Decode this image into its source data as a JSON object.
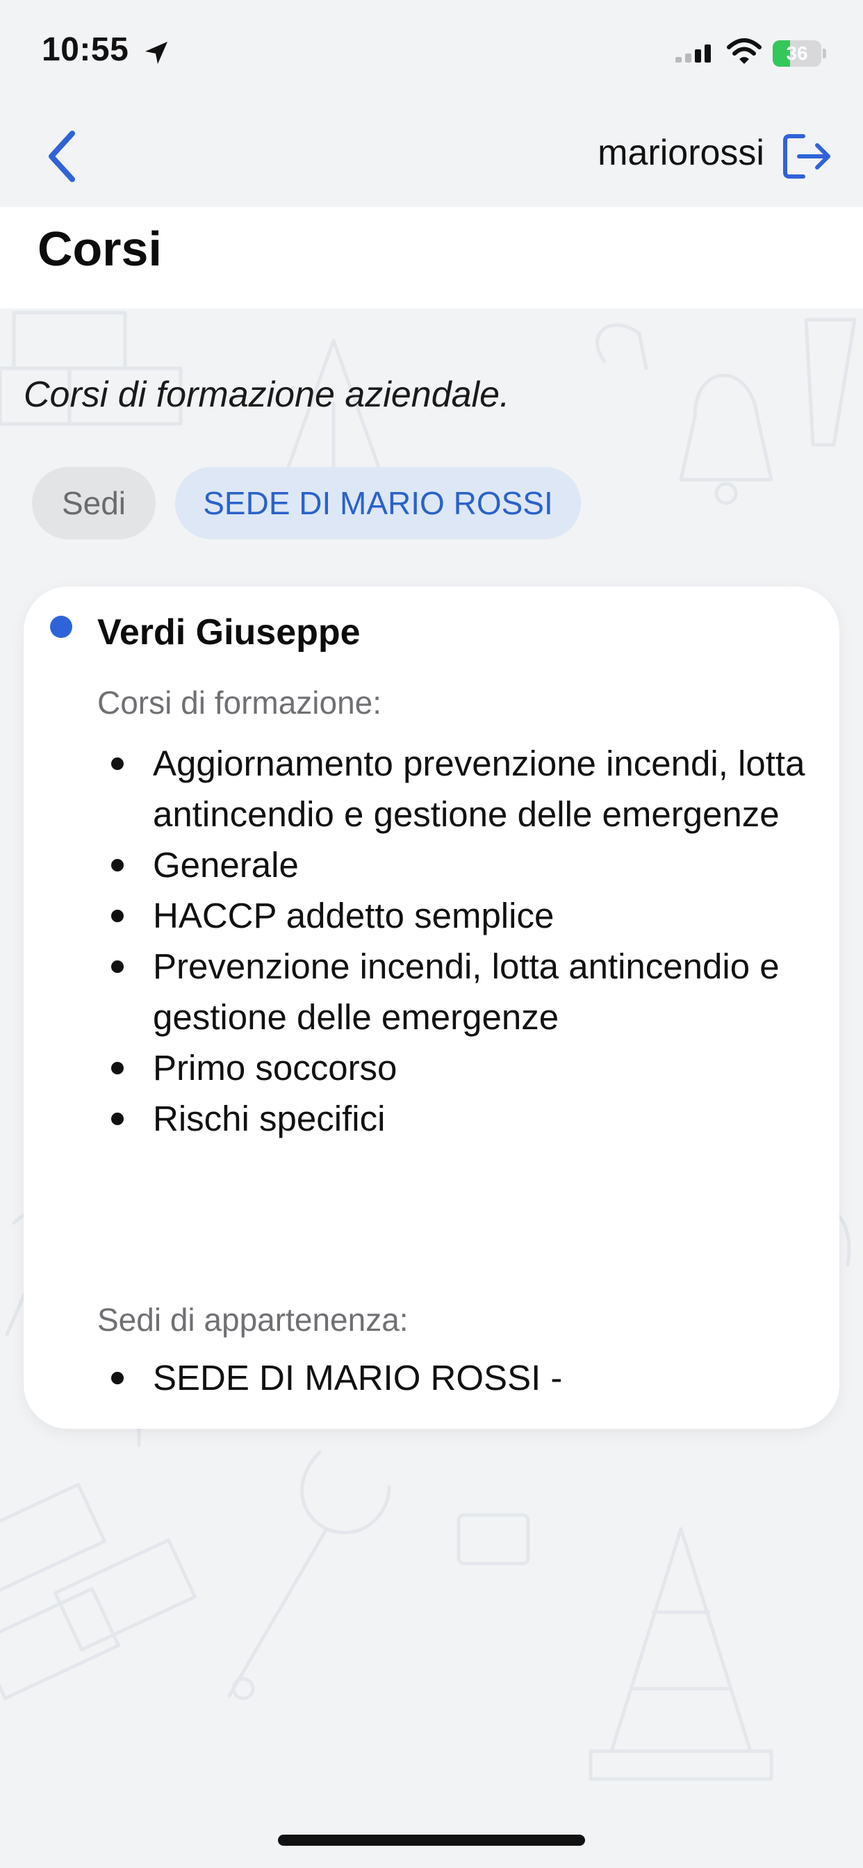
{
  "status_bar": {
    "time": "10:55",
    "battery_level": "36",
    "battery_percent": 36,
    "icons": [
      "location-arrow-icon",
      "cellular-signal-icon",
      "wifi-icon",
      "battery-charging-icon"
    ]
  },
  "nav": {
    "back_icon": "chevron-left-icon",
    "username": "mariorossi",
    "logout_icon": "logout-icon"
  },
  "page": {
    "title": "Corsi",
    "subtitle": "Corsi di formazione aziendale."
  },
  "chips": {
    "sedi_label": "Sedi",
    "selected_sede": "SEDE DI MARIO ROSSI"
  },
  "card": {
    "name": "Verdi Giuseppe",
    "courses_label": "Corsi di formazione:",
    "courses": [
      "Aggiornamento prevenzione incendi, lotta antincendio e gestione delle emergenze",
      "Generale",
      "HACCP addetto semplice",
      "Prevenzione incendi, lotta antincendio e gestione delle emergenze",
      "Primo soccorso",
      "Rischi specifici"
    ],
    "sedi_label": "Sedi di appartenenza:",
    "sedi": [
      "SEDE DI MARIO ROSSI -"
    ]
  },
  "colors": {
    "accent": "#2f63d8",
    "chip_selected_bg": "#dde7f6",
    "chip_bg": "#e3e4e6",
    "background": "#f2f3f5",
    "battery_fill": "#34c759"
  }
}
